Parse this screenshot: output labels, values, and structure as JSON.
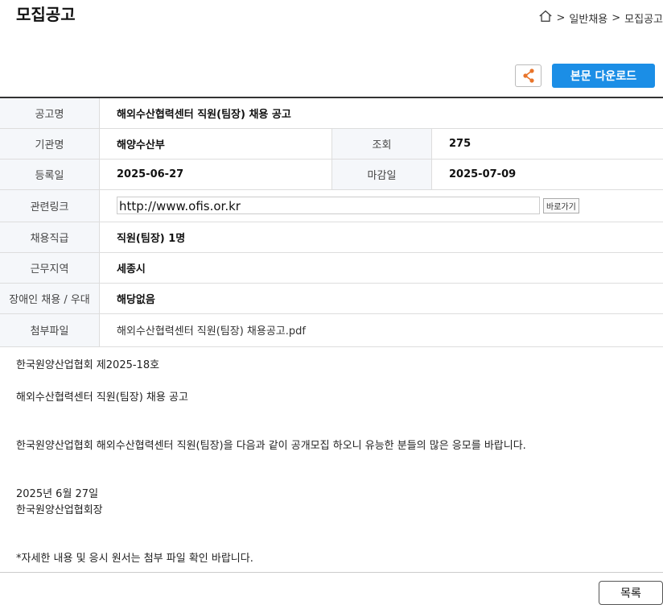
{
  "page_title": "모집공고",
  "breadcrumb": {
    "home_icon": "home-icon",
    "separator": ">",
    "items": [
      "일반채용",
      "모집공고"
    ]
  },
  "toolbar": {
    "share_icon": "share-icon",
    "share_color": "#e8742a",
    "download_label": "본문 다운로드",
    "download_color": "#1b8ee6"
  },
  "info": {
    "title_label": "공고명",
    "title_value": "해외수산협력센터 직원(팀장) 채용 공고",
    "org_label": "기관명",
    "org_value": "해양수산부",
    "views_label": "조회",
    "views_value": "275",
    "reg_label": "등록일",
    "reg_value": "2025-06-27",
    "deadline_label": "마감일",
    "deadline_value": "2025-07-09",
    "link_label": "관련링크",
    "link_value": "http://www.ofis.or.kr",
    "link_go": "바로가기",
    "grade_label": "채용직급",
    "grade_value": "직원(팀장) 1명",
    "region_label": "근무지역",
    "region_value": "세종시",
    "disability_label": "장애인 채용 / 우대",
    "disability_value": "해당없음",
    "file_label": "첨부파일",
    "file_value": "해외수산협력센터 직원(팀장) 채용공고.pdf"
  },
  "content": {
    "lines": [
      "한국원양산업협회 제2025-18호",
      "해외수산협력센터 직원(팀장) 채용 공고",
      "한국원양산업협회 해외수산협력센터 직원(팀장)을 다음과 같이 공개모집 하오니 유능한 분들의 많은 응모를 바랍니다.",
      "2025년 6월 27일",
      "한국원양산업협회장",
      "*자세한 내용 및 응시 원서는 첨부 파일 확인 바랍니다."
    ]
  },
  "list_button": "목록"
}
